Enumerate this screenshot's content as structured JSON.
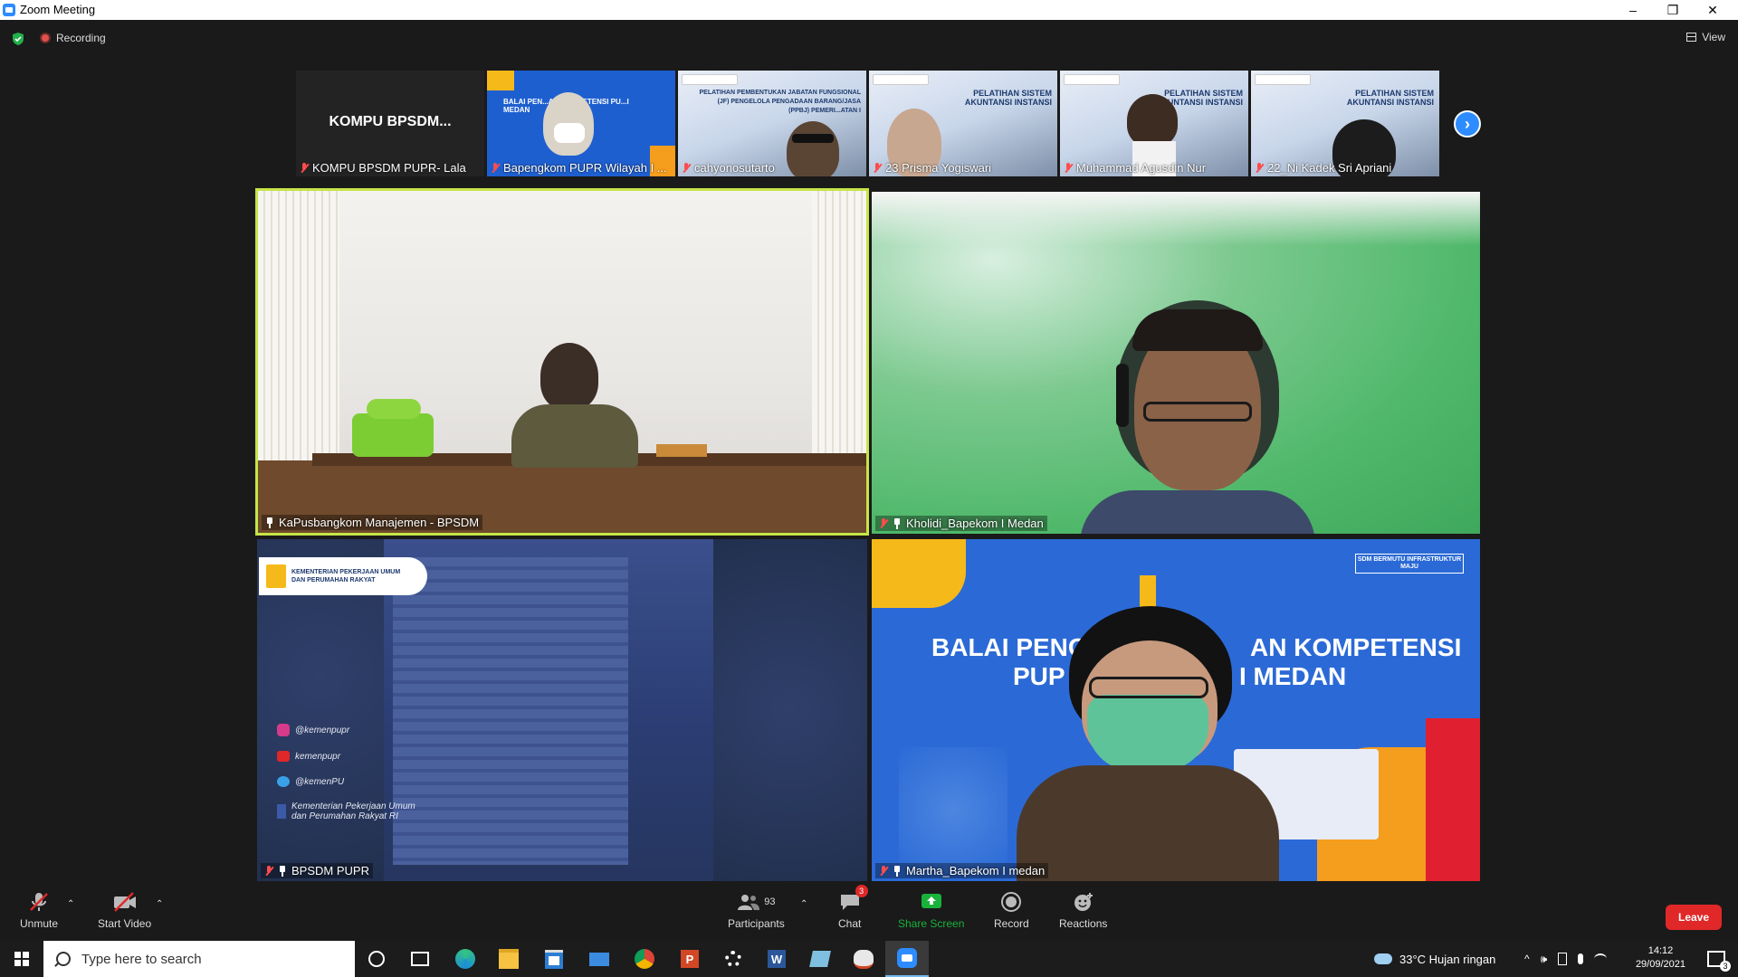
{
  "window": {
    "title": "Zoom Meeting",
    "minimize": "–",
    "restore": "❐",
    "close": "✕"
  },
  "header": {
    "recording_label": "Recording",
    "view_label": "View"
  },
  "strip": {
    "thumbnails": [
      {
        "name": "KOMPU BPSDM PUPR- Lala",
        "display_text": "KOMPU  BPSDM..."
      },
      {
        "name": "Bapengkom PUPR Wilayah I ...",
        "slide_text": "BALAI PEN...AN KOMPETENSI PU...I MEDAN"
      },
      {
        "name": "cahyonosutarto",
        "slide_text": "PELATIHAN PEMBENTUKAN JABATAN FUNGSIONAL (JF) PENGELOLA PENGADAAN BARANG/JASA (PPBJ) PEMERI...ATAN I"
      },
      {
        "name": "23 Prisma Yogiswari",
        "slide_text": "PELATIHAN SISTEM AKUNTANSI INSTANSI"
      },
      {
        "name": "Muhammad Agusdin Nur",
        "slide_text": "PELATIHAN SISTEM AKUNTANSI INSTANSI"
      },
      {
        "name": "22_Ni Kadek Sri Apriani",
        "slide_text": "PELATIHAN SISTEM AKUNTANSI INSTANSI"
      }
    ],
    "next_arrow": "›"
  },
  "tiles": {
    "t1": {
      "name": "KaPusbangkom Manajemen - BPSDM"
    },
    "t2": {
      "name": "Kholidi_Bapekom I Medan"
    },
    "t3": {
      "name": "BPSDM PUPR",
      "logo_text": "KEMENTERIAN PEKERJAAN UMUM DAN PERUMAHAN RAKYAT",
      "socials": [
        "@kemenpupr",
        "kemenpupr",
        "@kemenPU",
        "Kementerian Pekerjaan Umum dan Perumahan Rakyat RI"
      ]
    },
    "t4": {
      "name": "Martha_Bapekom I medan",
      "banner_line1": "BALAI PENG",
      "banner_line1b": "AN KOMPETENSI",
      "banner_line2": "PUP",
      "banner_line2b": "H I MEDAN",
      "tag": "SDM BERMUTU INFRASTRUKTUR MAJU"
    }
  },
  "toolbar": {
    "unmute": "Unmute",
    "start_video": "Start Video",
    "participants": "Participants",
    "participants_count": "93",
    "chat": "Chat",
    "chat_badge": "3",
    "share_screen": "Share Screen",
    "record": "Record",
    "reactions": "Reactions",
    "leave": "Leave"
  },
  "taskbar": {
    "search_placeholder": "Type here to search",
    "weather": "33°C  Hujan ringan",
    "time": "14:12",
    "date": "29/09/2021",
    "notification_count": "3"
  },
  "colors": {
    "accent": "#2d8cff",
    "speaker_border": "#c6e447",
    "leave": "#e02828",
    "share_green": "#19b23b"
  }
}
